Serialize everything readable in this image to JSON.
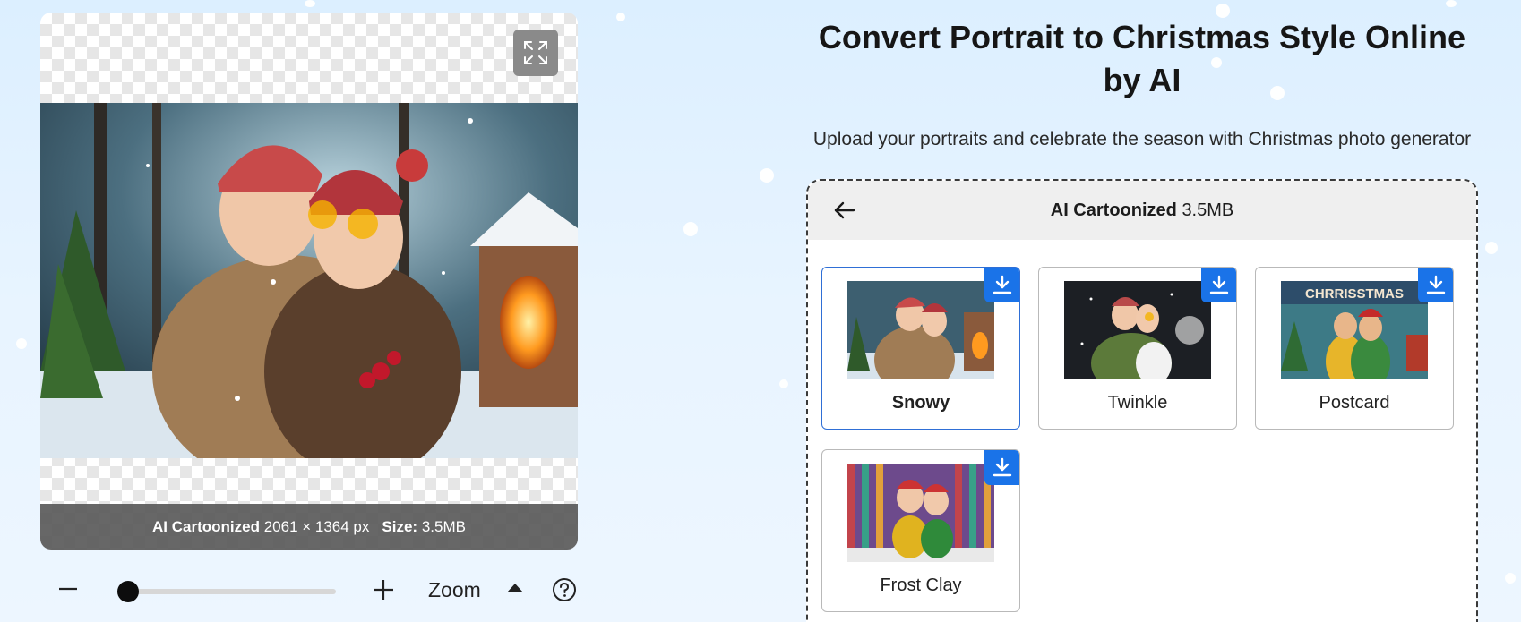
{
  "preview": {
    "info_label": "AI Cartoonized",
    "dimensions": "2061 × 1364 px",
    "size_label": "Size:",
    "size_value": "3.5MB"
  },
  "zoom": {
    "label": "Zoom",
    "level": 0.05
  },
  "header": {
    "title": "Convert Portrait to Christmas Style Online by AI",
    "subtitle": "Upload your portraits and celebrate the season with Christmas photo generator"
  },
  "results": {
    "title_bold": "AI Cartoonized",
    "title_size": "3.5MB",
    "styles": [
      {
        "label": "Snowy",
        "selected": true
      },
      {
        "label": "Twinkle",
        "selected": false
      },
      {
        "label": "Postcard",
        "selected": false
      },
      {
        "label": "Frost Clay",
        "selected": false
      }
    ],
    "postcard_text": "CHRRISSTMAS"
  },
  "colors": {
    "accent": "#1a73e8",
    "selected_border": "#2f6fd6"
  },
  "icons": {
    "expand": "expand-arrows-icon",
    "back": "arrow-left-icon",
    "download": "download-icon",
    "zoom_out": "minus-icon",
    "zoom_in": "plus-icon",
    "help": "question-circle-icon",
    "caret": "caret-up-icon"
  }
}
